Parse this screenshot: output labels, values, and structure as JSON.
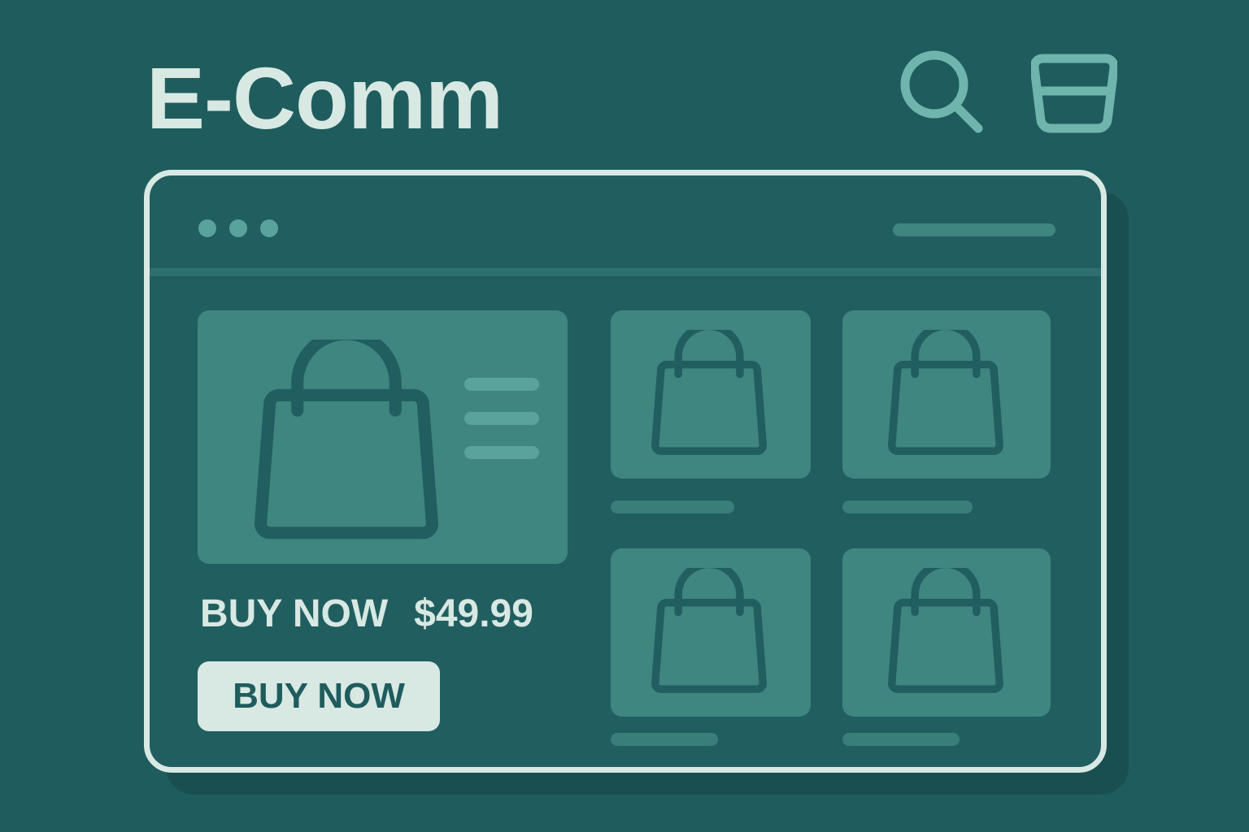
{
  "header": {
    "logo": "E-Comm",
    "icons": [
      "search-icon",
      "shopping-basket-icon"
    ]
  },
  "browser": {
    "window_dots": 3
  },
  "featured": {
    "headline": "BUY NOW",
    "price": "$49.99",
    "button_label": "BUY NOW"
  },
  "products": {
    "count": 4
  },
  "colors": {
    "background": "#1f5c5e",
    "accent": "#6fb5ad",
    "light": "#d8e8e2",
    "card": "#3f8580"
  }
}
